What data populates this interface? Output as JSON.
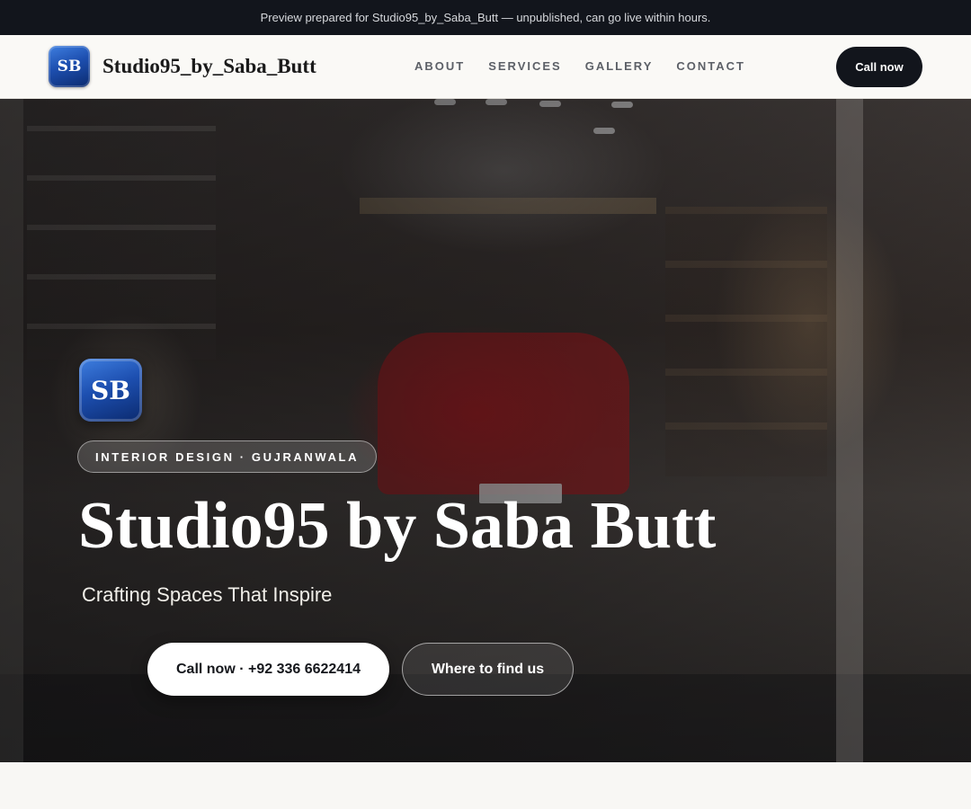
{
  "preview_banner": "Preview prepared for Studio95_by_Saba_Butt — unpublished, can go live within hours.",
  "brand": {
    "logo_initials": "SB",
    "name": "Studio95_by_Saba_Butt",
    "logo_color": "#1d4fb0"
  },
  "nav": {
    "links": [
      "ABOUT",
      "SERVICES",
      "GALLERY",
      "CONTACT"
    ],
    "cta_label": "Call now"
  },
  "hero": {
    "logo_initials": "SB",
    "tagline_pill": "INTERIOR DESIGN · GUJRANWALA",
    "title": "Studio95 by Saba Butt",
    "subtitle": "Crafting Spaces That Inspire",
    "primary_button": "Call now · +92 336 6622414",
    "secondary_button": "Where to find us",
    "background_image": "store-interior-photo"
  },
  "colors": {
    "dark": "#12151c",
    "page_bg": "#f8f7f4",
    "accent_blue": "#1d4fb0"
  }
}
